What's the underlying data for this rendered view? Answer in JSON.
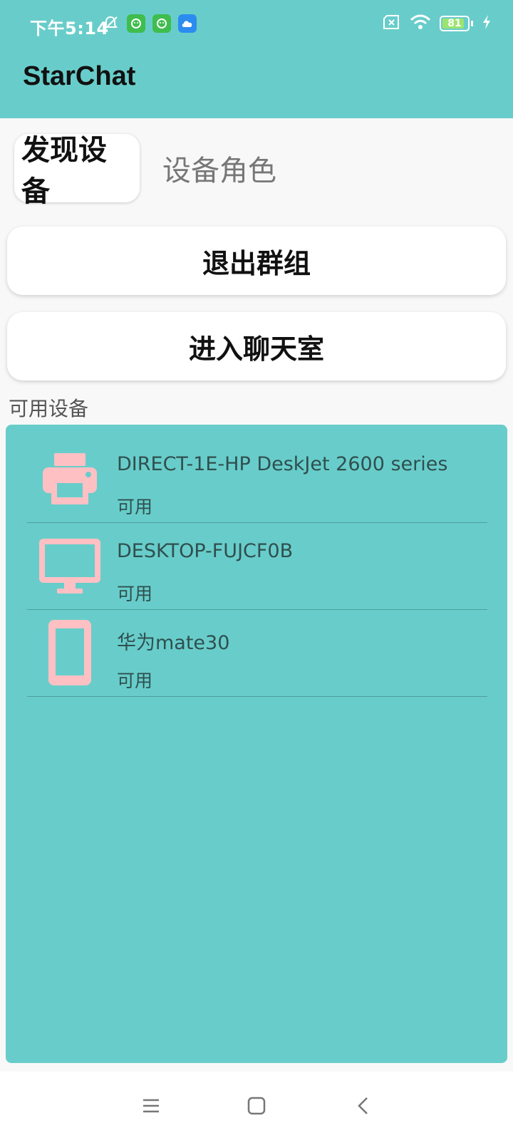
{
  "status_bar": {
    "time": "下午5:14",
    "battery_level": "81",
    "icons": [
      "mute-bell-icon",
      "green-app-icon",
      "green-app-icon",
      "cloud-icon",
      "sim-none-icon",
      "wifi-icon",
      "battery-icon",
      "charging-icon"
    ]
  },
  "app_bar": {
    "title": "StarChat"
  },
  "tabs": [
    {
      "label": "发现设备",
      "active": true
    },
    {
      "label": "设备角色",
      "active": false
    }
  ],
  "actions": {
    "exit_group": "退出群组",
    "enter_chat": "进入聊天室"
  },
  "devices_section": {
    "label": "可用设备",
    "devices": [
      {
        "name": "DIRECT-1E-HP DeskJet 2600 series",
        "status": "可用",
        "icon": "printer-icon"
      },
      {
        "name": "DESKTOP-FUJCF0B",
        "status": "可用",
        "icon": "monitor-icon"
      },
      {
        "name": "华为mate30",
        "status": "可用",
        "icon": "phone-icon"
      }
    ]
  },
  "colors": {
    "primary": "#68CDCA",
    "icon_pink": "#FFC0C4",
    "text_dark": "#2F4F4F"
  },
  "nav_bar": {
    "icons": [
      "menu-icon",
      "home-icon",
      "back-icon"
    ]
  }
}
